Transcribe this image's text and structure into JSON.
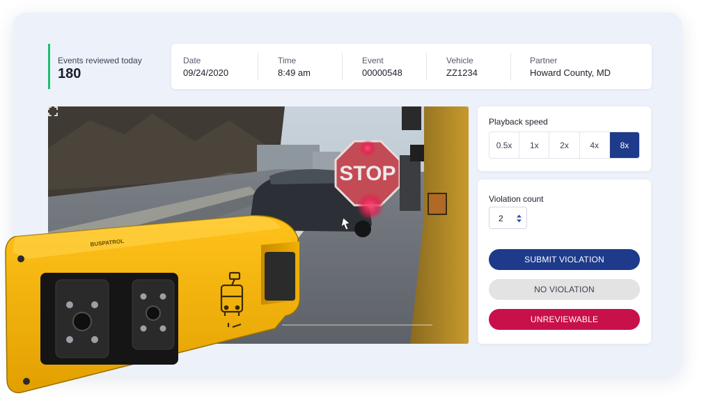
{
  "stats": {
    "label": "Events reviewed today",
    "value": "180"
  },
  "event_info": {
    "fields": [
      {
        "label": "Date",
        "value": "09/24/2020"
      },
      {
        "label": "Time",
        "value": "8:49 am"
      },
      {
        "label": "Event",
        "value": "00000548"
      },
      {
        "label": "Vehicle",
        "value": "ZZ1234"
      },
      {
        "label": "Partner",
        "value": "Howard County, MD"
      }
    ]
  },
  "video": {
    "sign_text": "STOP",
    "icons": {
      "fullscreen": "fullscreen-icon",
      "cursor": "cursor-icon"
    }
  },
  "playback": {
    "title": "Playback speed",
    "options": [
      "0.5x",
      "1x",
      "2x",
      "4x",
      "8x"
    ],
    "selected": "8x"
  },
  "violation": {
    "title": "Violation count",
    "count": "2",
    "buttons": {
      "submit": "SUBMIT VIOLATION",
      "none": "NO VIOLATION",
      "unreviewable": "UNREVIEWABLE"
    }
  },
  "device": {
    "brand": "BUSPATROL",
    "icon": "bus-camera-icon",
    "color": "#f5b400"
  },
  "colors": {
    "accent_blue": "#1e3a8a",
    "accent_green": "#1dbf73",
    "danger": "#c8104a",
    "panel_bg": "#edf1fa"
  }
}
